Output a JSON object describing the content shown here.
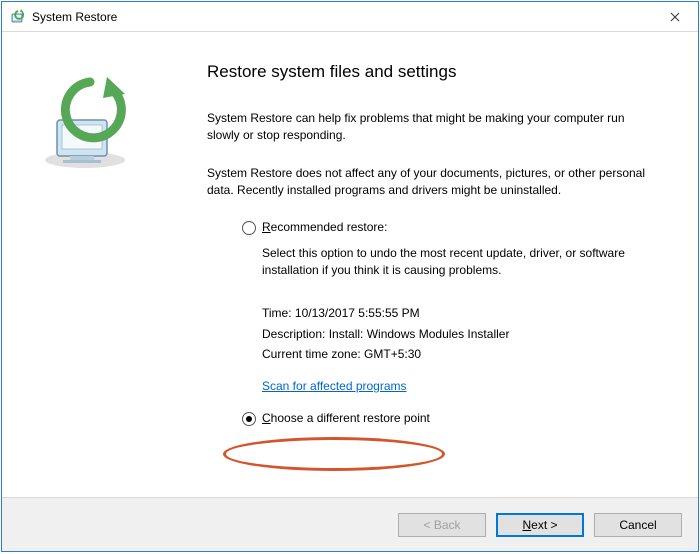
{
  "window": {
    "title": "System Restore"
  },
  "heading": "Restore system files and settings",
  "intro1": "System Restore can help fix problems that might be making your computer run slowly or stop responding.",
  "intro2": "System Restore does not affect any of your documents, pictures, or other personal data. Recently installed programs and drivers might be uninstalled.",
  "recommended": {
    "label_prefix": "R",
    "label_rest": "ecommended restore:",
    "desc": "Select this option to undo the most recent update, driver, or software installation if you think it is causing problems.",
    "time_label": "Time: ",
    "time_value": "10/13/2017 5:55:55 PM",
    "desc_label": "Description: ",
    "desc_value": "Install: Windows Modules Installer",
    "tz_label": "Current time zone: ",
    "tz_value": "GMT+5:30",
    "scan_link": "Scan for affected programs"
  },
  "choose": {
    "label_prefix": "C",
    "label_rest": "hoose a different restore point"
  },
  "buttons": {
    "back": "< Back",
    "next": "Next >",
    "cancel": "Cancel"
  }
}
